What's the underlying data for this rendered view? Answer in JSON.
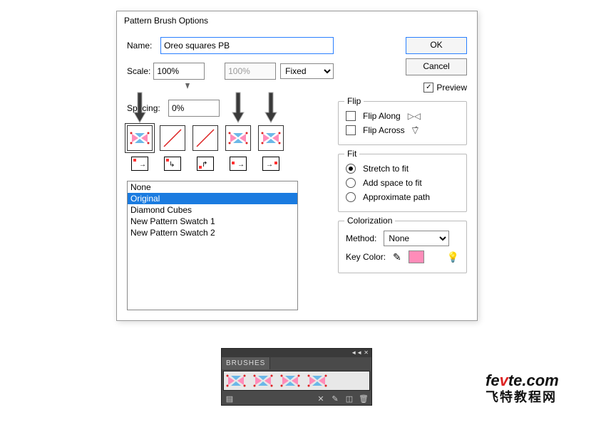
{
  "dialog": {
    "title": "Pattern Brush Options",
    "name_label": "Name:",
    "name_value": "Oreo squares PB",
    "scale_label": "Scale:",
    "scale_value": "100%",
    "scale_value2": "100%",
    "scale_mode": "Fixed",
    "spacing_label": "Spacing:",
    "spacing_value": "0%",
    "swatch_list": [
      "None",
      "Original",
      "Diamond Cubes",
      "New Pattern Swatch 1",
      "New Pattern Swatch 2"
    ],
    "selected_index": 1
  },
  "buttons": {
    "ok": "OK",
    "cancel": "Cancel"
  },
  "preview": {
    "label": "Preview",
    "checked": true
  },
  "flip": {
    "title": "Flip",
    "along": "Flip Along",
    "across": "Flip Across"
  },
  "fit": {
    "title": "Fit",
    "stretch": "Stretch to fit",
    "add": "Add space to fit",
    "approx": "Approximate path",
    "selected": "stretch"
  },
  "color": {
    "title": "Colorization",
    "method_label": "Method:",
    "method_value": "None",
    "key_label": "Key Color:"
  },
  "brushes": {
    "tab": "BRUSHES",
    "head": "◄◄ ✕"
  },
  "logo": {
    "en1": "fe",
    "enV": "v",
    "en2": "te",
    "dot": ".com",
    "zh": "飞特教程网"
  }
}
